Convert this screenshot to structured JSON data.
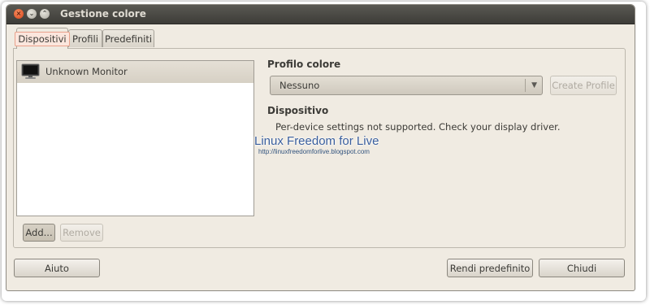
{
  "window": {
    "title": "Gestione colore",
    "buttons": {
      "close": "×",
      "minimize": "⌄",
      "maximize": "⌃"
    }
  },
  "tabs": [
    {
      "label": "Dispositivi",
      "active": true
    },
    {
      "label": "Profili",
      "active": false
    },
    {
      "label": "Predefiniti",
      "active": false
    }
  ],
  "devices": {
    "items": [
      {
        "name": "Unknown Monitor",
        "icon": "monitor-icon",
        "selected": true
      }
    ],
    "add_label": "Add...",
    "remove_label": "Remove"
  },
  "profile": {
    "heading": "Profilo colore",
    "selected_value": "Nessuno",
    "create_label": "Create Profile"
  },
  "device_info": {
    "heading": "Dispositivo",
    "message": "Per-device settings not supported. Check your display driver."
  },
  "watermark": {
    "title": "Linux Freedom for Live",
    "url": "http://linuxfreedomforlive.blogspot.com"
  },
  "footer": {
    "help_label": "Aiuto",
    "make_default_label": "Rendi predefinito",
    "close_label": "Chiudi"
  },
  "colors": {
    "window_bg": "#f0ebe2",
    "titlebar": "#3d3c38",
    "close_button": "#d9441a",
    "active_tab_highlight": "#e9a18b"
  }
}
